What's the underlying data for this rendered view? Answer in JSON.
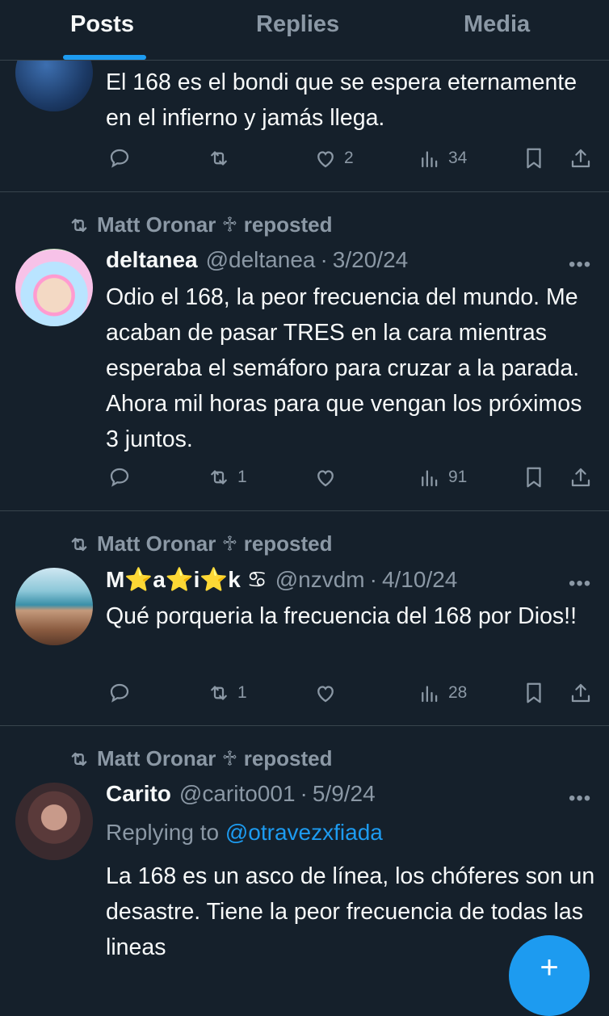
{
  "tabs": [
    {
      "label": "Posts"
    },
    {
      "label": "Replies"
    },
    {
      "label": "Media"
    }
  ],
  "posts": [
    {
      "text": "El 168 es el bondi que se espera eternamente en el infierno y jamás llega.",
      "counts": {
        "replies": "",
        "reposts": "",
        "likes": "2",
        "views": "34"
      }
    },
    {
      "repost_by": "Matt Oronar ♱ reposted",
      "name": "deltanea",
      "handle": "@deltanea",
      "date": "3/20/24",
      "text": "Odio el 168, la peor frecuencia del mundo. Me acaban de pasar TRES en la cara mientras esperaba el semáforo para cruzar a la parada. Ahora mil horas para que vengan los próximos 3 juntos.",
      "counts": {
        "replies": "",
        "reposts": "1",
        "likes": "",
        "views": "91"
      }
    },
    {
      "repost_by": "Matt Oronar ♱ reposted",
      "name": "M⭐a⭐i⭐k ♋︎",
      "handle": "@nzvdm",
      "date": "4/10/24",
      "text": "Qué porqueria la frecuencia del 168 por Dios!!",
      "counts": {
        "replies": "",
        "reposts": "1",
        "likes": "",
        "views": "28"
      }
    },
    {
      "repost_by": "Matt Oronar ♱ reposted",
      "name": "Carito",
      "handle": "@carito001",
      "date": "5/9/24",
      "replying_prefix": "Replying to",
      "replying_to": "@otravezxfiada",
      "text": "La 168 es un asco de línea, los chóferes son un desastre. Tiene la peor frecuencia de todas las lineas"
    }
  ],
  "ui": {
    "dot": "·",
    "more": "•••",
    "fab_icon": "+"
  },
  "icons": [
    "reply-icon",
    "repost-icon",
    "like-icon",
    "views-icon",
    "bookmark-icon",
    "share-icon"
  ],
  "colors": {
    "background": "#15202b",
    "text": "#f7f9f9",
    "muted": "#8b98a5",
    "accent": "#1d9bf0",
    "divider": "#38444d"
  }
}
